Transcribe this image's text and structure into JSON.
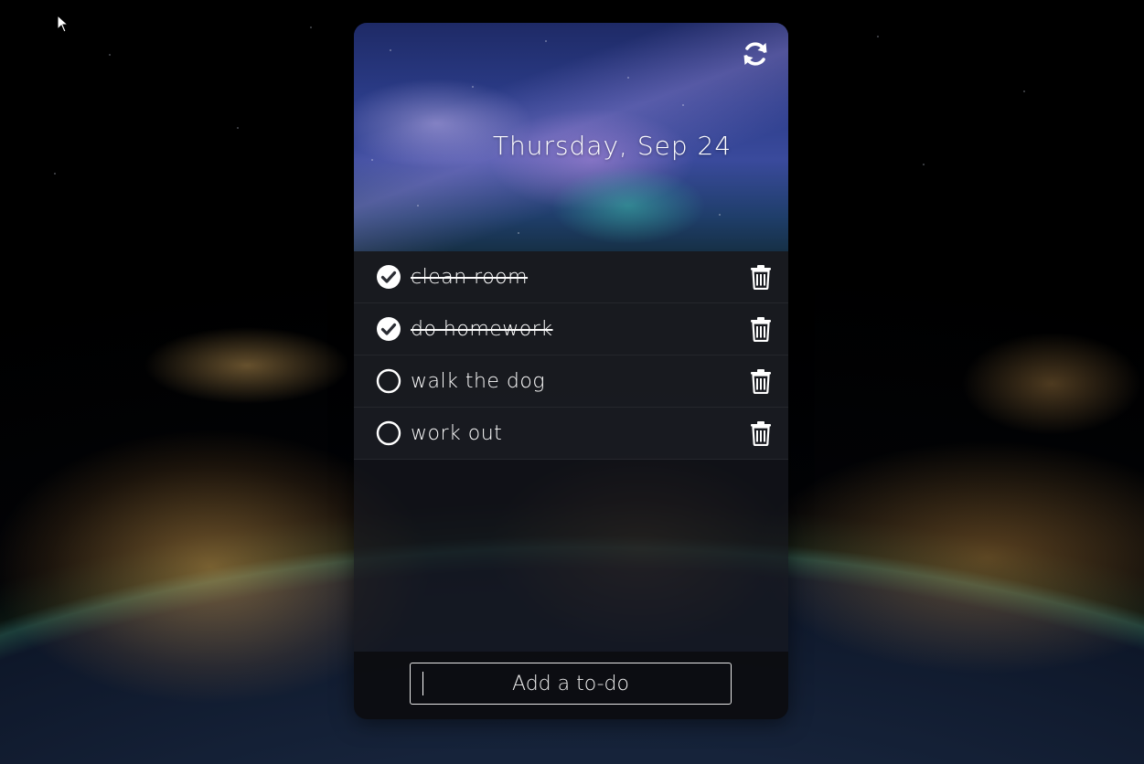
{
  "header": {
    "date": "Thursday, Sep 24",
    "refresh_icon": "refresh-icon"
  },
  "todos": [
    {
      "text": "clean room",
      "done": true
    },
    {
      "text": "do homework",
      "done": true
    },
    {
      "text": "walk the dog",
      "done": false
    },
    {
      "text": "work out",
      "done": false
    }
  ],
  "add_todo": {
    "placeholder": "Add a to-do",
    "value": ""
  },
  "colors": {
    "text": "#ffffff",
    "card_background": "#16181e"
  }
}
